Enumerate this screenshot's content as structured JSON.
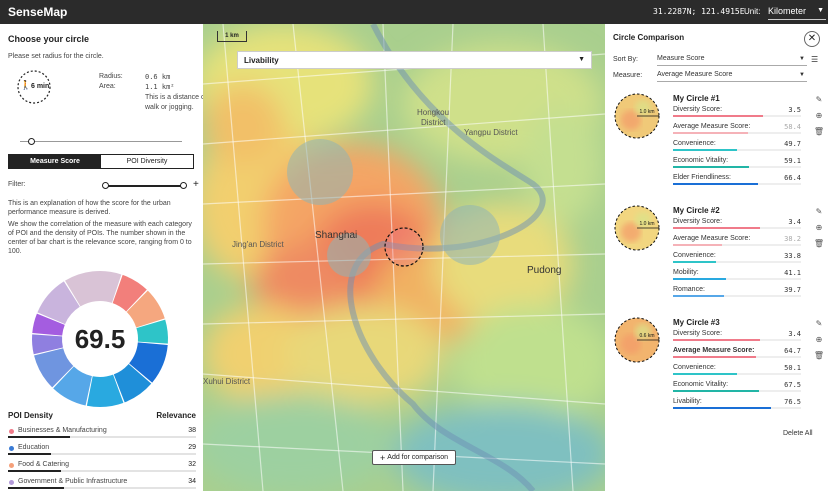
{
  "app": {
    "title": "SenseMap",
    "coords": "31.2287N; 121.4915E",
    "unit_label": "Unit:",
    "unit_value": "Kilometer"
  },
  "left": {
    "heading": "Choose your circle",
    "hint": "Please set radius for the circle.",
    "walk_minutes": "6 min",
    "radius_label": "Radius:",
    "radius_value": "0.6 km",
    "area_label": "Area:",
    "area_value": "1.1 km²",
    "distance_desc": "This is a distance of 6-minute walk or jogging.",
    "radius_slider": 0.05,
    "tabs": [
      "Measure Score",
      "POI Diversity"
    ],
    "active_tab": 0,
    "filter_label": "Filter:",
    "filter_range": [
      0,
      1
    ],
    "explain_1": "This is an explanation of how the score for the urban performance measure is derived.",
    "explain_2": "We show the correlation of the measure with each category of POI and the density of POIs. The number shown in the center of bar chart is the relevance score, ranging from 0 to 100.",
    "score": "69.5",
    "poi_density_label": "POI Density",
    "relevance_label": "Relevance",
    "poi_items": [
      {
        "label": "Businesses & Manufacturing",
        "value": "38",
        "color": "#f07b8a",
        "density": 0.33
      },
      {
        "label": "Education",
        "value": "29",
        "color": "#3a7bd5",
        "density": 0.23
      },
      {
        "label": "Food & Catering",
        "value": "32",
        "color": "#f5a07a",
        "density": 0.28
      },
      {
        "label": "Government & Public Infrastructure",
        "value": "34",
        "color": "#b39ad9",
        "density": 0.3
      }
    ],
    "donut_segments": [
      {
        "color": "#d9c3d6",
        "value": 14
      },
      {
        "color": "#f27f7b",
        "value": 7
      },
      {
        "color": "#f5a77f",
        "value": 8
      },
      {
        "color": "#2ec4c8",
        "value": 6
      },
      {
        "color": "#1a6fd6",
        "value": 10
      },
      {
        "color": "#1f8fd9",
        "value": 8
      },
      {
        "color": "#29a9e0",
        "value": 9
      },
      {
        "color": "#56a7e8",
        "value": 9
      },
      {
        "color": "#6f95e0",
        "value": 9
      },
      {
        "color": "#8f7fe0",
        "value": 5
      },
      {
        "color": "#a45de0",
        "value": 5
      },
      {
        "color": "#c9b4dd",
        "value": 10
      }
    ]
  },
  "map": {
    "layer": "Livability",
    "scale": "1 km",
    "labels": [
      {
        "text": "Hongkou",
        "big": false
      },
      {
        "text": "District",
        "big": false
      },
      {
        "text": "Yangpu District",
        "big": false
      },
      {
        "text": "Shanghai",
        "big": true
      },
      {
        "text": "Jing'an District",
        "big": false
      },
      {
        "text": "Pudong",
        "big": true
      },
      {
        "text": "Xuhui District",
        "big": false
      }
    ],
    "add_button": "Add for comparison"
  },
  "right": {
    "heading": "Circle Comparison",
    "sort_label": "Sort By:",
    "sort_value": "Measure Score",
    "measure_label": "Measure:",
    "measure_value": "Average Measure Score",
    "delete_all": "Delete All",
    "circles": [
      {
        "title": "My Circle #1",
        "radius": "1.0 km",
        "metrics": [
          {
            "label": "Diversity Score:",
            "value": "3.5",
            "frac": 0.7,
            "color": "#f07b8a",
            "dim": false,
            "bold": false
          },
          {
            "label": "Average Measure Score:",
            "value": "58.4",
            "frac": 0.584,
            "color": "#f5b2b8",
            "dim": true,
            "bold": false
          },
          {
            "label": "Convenience:",
            "value": "49.7",
            "frac": 0.497,
            "color": "#2ec4c8",
            "dim": false,
            "bold": false
          },
          {
            "label": "Economic Vitality:",
            "value": "59.1",
            "frac": 0.591,
            "color": "#22b5a6",
            "dim": false,
            "bold": false
          },
          {
            "label": "Elder Friendliness:",
            "value": "66.4",
            "frac": 0.664,
            "color": "#1a6fd6",
            "dim": false,
            "bold": false
          }
        ]
      },
      {
        "title": "My Circle #2",
        "radius": "1.0 km",
        "metrics": [
          {
            "label": "Diversity Score:",
            "value": "3.4",
            "frac": 0.68,
            "color": "#f07b8a",
            "dim": false,
            "bold": false
          },
          {
            "label": "Average Measure Score:",
            "value": "38.2",
            "frac": 0.382,
            "color": "#f5b2b8",
            "dim": true,
            "bold": false
          },
          {
            "label": "Convenience:",
            "value": "33.8",
            "frac": 0.338,
            "color": "#2ec4c8",
            "dim": false,
            "bold": false
          },
          {
            "label": "Mobility:",
            "value": "41.1",
            "frac": 0.411,
            "color": "#29a9e0",
            "dim": false,
            "bold": false
          },
          {
            "label": "Romance:",
            "value": "39.7",
            "frac": 0.397,
            "color": "#56a7e8",
            "dim": false,
            "bold": false
          }
        ]
      },
      {
        "title": "My Circle #3",
        "radius": "0.6 km",
        "metrics": [
          {
            "label": "Diversity Score:",
            "value": "3.4",
            "frac": 0.68,
            "color": "#f07b8a",
            "dim": false,
            "bold": false
          },
          {
            "label": "Average Measure Score:",
            "value": "64.7",
            "frac": 0.647,
            "color": "#f07b8a",
            "dim": false,
            "bold": true
          },
          {
            "label": "Convenience:",
            "value": "50.1",
            "frac": 0.501,
            "color": "#2ec4c8",
            "dim": false,
            "bold": false
          },
          {
            "label": "Economic Vitality:",
            "value": "67.5",
            "frac": 0.675,
            "color": "#22b5a6",
            "dim": false,
            "bold": false
          },
          {
            "label": "Livability:",
            "value": "76.5",
            "frac": 0.765,
            "color": "#1a6fd6",
            "dim": false,
            "bold": false
          }
        ]
      }
    ]
  }
}
